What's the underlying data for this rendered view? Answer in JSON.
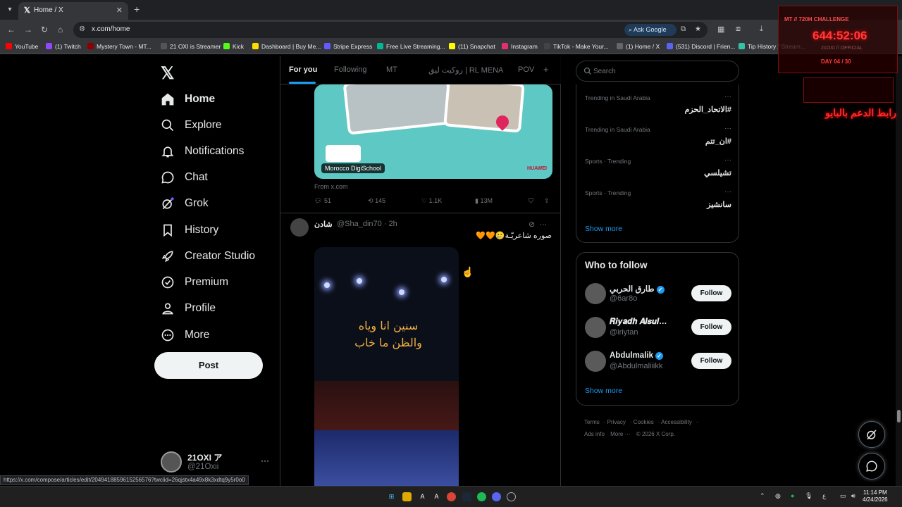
{
  "browser": {
    "tab_title": "Home / X",
    "url": "x.com/home",
    "ask_google": "Ask Google",
    "bookmarks": [
      {
        "label": "YouTube",
        "color": "#ff0000"
      },
      {
        "label": "(1) Twitch",
        "color": "#9146ff"
      },
      {
        "label": "Mystery Town - MT...",
        "color": "#8b0000"
      },
      {
        "label": "21 OXI is Streamer",
        "color": "#222222"
      },
      {
        "label": "Kick",
        "color": "#53fc18"
      },
      {
        "label": "Dashboard | Buy Me...",
        "color": "#ffdd00"
      },
      {
        "label": "Stripe Express",
        "color": "#635bff"
      },
      {
        "label": "Free Live Streaming...",
        "color": "#00b894"
      },
      {
        "label": "(11) Snapchat",
        "color": "#fffc00"
      },
      {
        "label": "Instagram",
        "color": "#e1306c"
      },
      {
        "label": "TikTok - Make Your...",
        "color": "#111111"
      },
      {
        "label": "(1) Home / X",
        "color": "#000000"
      },
      {
        "label": "(531) Discord | Frien...",
        "color": "#5865f2"
      },
      {
        "label": "Tip History / Stream...",
        "color": "#32c3a6"
      }
    ],
    "status_url": "https://x.com/compose/articles/edit/2049418859615256576?twclid=26qjstx4a49x8k3xdtq9y5r0o0"
  },
  "nav": {
    "items": [
      {
        "label": "Home",
        "icon": "home-icon"
      },
      {
        "label": "Explore",
        "icon": "search-icon"
      },
      {
        "label": "Notifications",
        "icon": "bell-icon"
      },
      {
        "label": "Chat",
        "icon": "chat-icon"
      },
      {
        "label": "Grok",
        "icon": "grok-icon"
      },
      {
        "label": "History",
        "icon": "bookmark-icon"
      },
      {
        "label": "Creator Studio",
        "icon": "rocket-icon"
      },
      {
        "label": "Premium",
        "icon": "verified-icon"
      },
      {
        "label": "Profile",
        "icon": "person-icon"
      },
      {
        "label": "More",
        "icon": "more-circle-icon"
      }
    ],
    "post_label": "Post",
    "account": {
      "name": "21OXI ア",
      "handle": "@21Oxii",
      "more": "···"
    }
  },
  "timeline": {
    "tabs": [
      "For you",
      "Following",
      "MT",
      "روكيت ليق | RL MENA",
      "POV"
    ],
    "plus": "+",
    "card": {
      "label": "Morocco DigiSchool",
      "brand": "HUAWEI",
      "from": "From x.com",
      "replies": "51",
      "reposts": "145",
      "likes": "1.1K",
      "views": "13M"
    },
    "tweet": {
      "name": "شادن",
      "handle": "@Sha_din70",
      "time": "2h",
      "text": "صوره شاعريّـة🥲🧡🧡",
      "media_text_line1": "سنين انا وياه",
      "media_text_line2": "والظن ما خاب"
    }
  },
  "sidebar": {
    "search_placeholder": "Search",
    "trends": [
      {
        "category": "Trending in Saudi Arabia",
        "name": "#الاتحاد_الحزم"
      },
      {
        "category": "Trending in Saudi Arabia",
        "name": "#ان_تتم"
      },
      {
        "category": "Sports · Trending",
        "name": "تشيلسي"
      },
      {
        "category": "Sports · Trending",
        "name": "سانشيز"
      }
    ],
    "show_more": "Show more",
    "who_to_follow": {
      "title": "Who to follow",
      "users": [
        {
          "name": "طارق الحربي",
          "handle": "@6ar8o",
          "verified": true
        },
        {
          "name": "𝑹𝒊𝒚𝒂𝒅𝒉 𝑨𝒍𝒔𝒖𝒍…",
          "handle": "@iriytan",
          "verified": false
        },
        {
          "name": "Abdulmalik",
          "handle": "@Abdulmaliiikk",
          "verified": true
        }
      ],
      "follow_label": "Follow",
      "show_more": "Show more"
    },
    "footer": [
      "Terms",
      "Privacy",
      "Cookies",
      "Accessibility",
      "Ads info",
      "More ···",
      "© 2026 X Corp."
    ]
  },
  "overlay": {
    "title": "MT // 720H CHALLENGE",
    "timer": "644:52:06",
    "sub": "21OXI // OFFICIAL",
    "day": "DAY 04 / 30",
    "arabic": "رابط الدعم بالبايو"
  },
  "taskbar": {
    "time": "11:14 PM",
    "date": "4/24/2026"
  }
}
